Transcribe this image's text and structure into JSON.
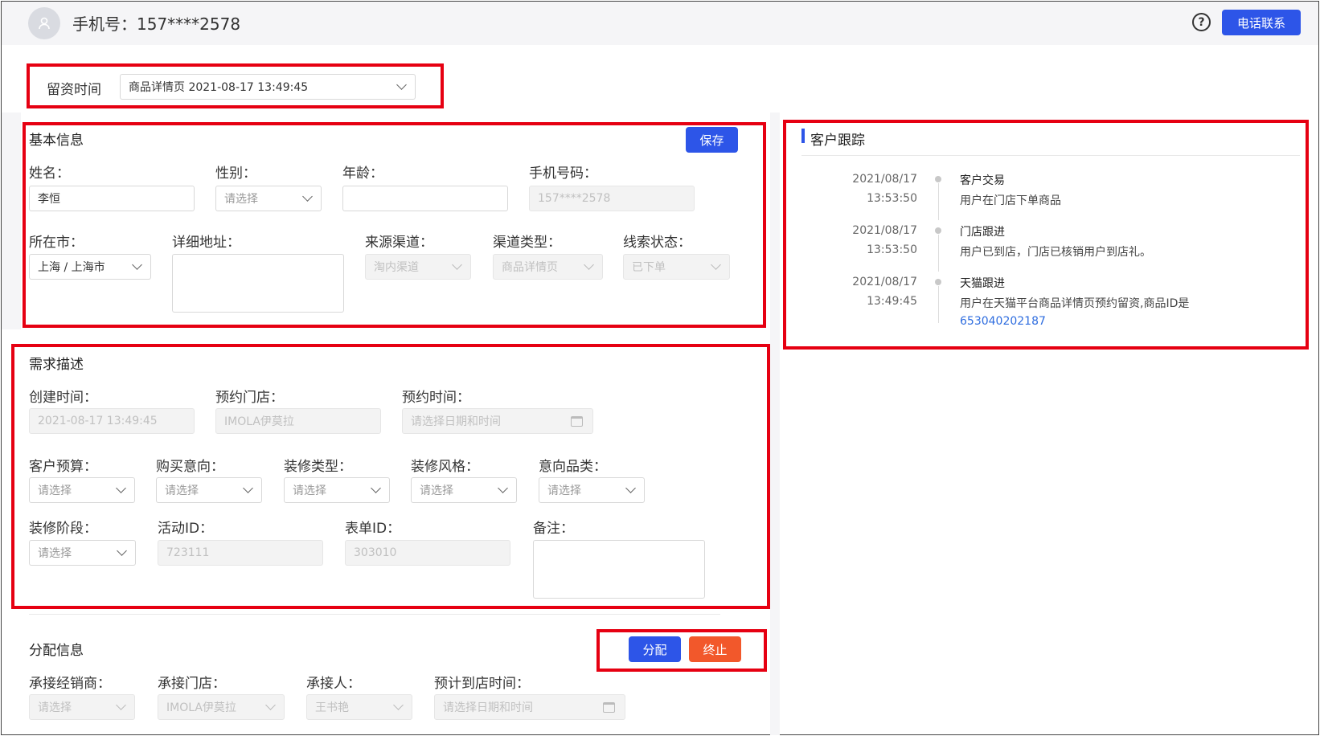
{
  "header": {
    "title": "手机号：157****2578",
    "help_icon": "?",
    "call_button": "电话联系"
  },
  "lead_time": {
    "label": "留资时间",
    "value": "商品详情页 2021-08-17 13:49:45"
  },
  "basic_info": {
    "title": "基本信息",
    "save_button": "保存",
    "name": {
      "label": "姓名：",
      "value": "李恒"
    },
    "gender": {
      "label": "性别：",
      "placeholder": "请选择"
    },
    "age": {
      "label": "年龄：",
      "value": ""
    },
    "phone": {
      "label": "手机号码：",
      "value": "157****2578"
    },
    "city": {
      "label": "所在市：",
      "value": "上海 / 上海市"
    },
    "address": {
      "label": "详细地址：",
      "value": ""
    },
    "source_channel": {
      "label": "来源渠道：",
      "value": "淘内渠道"
    },
    "channel_type": {
      "label": "渠道类型：",
      "value": "商品详情页"
    },
    "lead_status": {
      "label": "线索状态：",
      "value": "已下单"
    }
  },
  "tracking": {
    "title": "客户跟踪",
    "events": [
      {
        "date": "2021/08/17",
        "time": "13:53:50",
        "title": "客户交易",
        "desc": "用户在门店下单商品",
        "link": ""
      },
      {
        "date": "2021/08/17",
        "time": "13:53:50",
        "title": "门店跟进",
        "desc": "用户已到店，门店已核销用户到店礼。",
        "link": ""
      },
      {
        "date": "2021/08/17",
        "time": "13:49:45",
        "title": "天猫跟进",
        "desc": "用户在天猫平台商品详情页预约留资,商品ID是",
        "link": "653040202187"
      }
    ]
  },
  "demand": {
    "title": "需求描述",
    "created_time": {
      "label": "创建时间：",
      "value": "2021-08-17 13:49:45"
    },
    "store": {
      "label": "预约门店：",
      "value": "IMOLA伊莫拉"
    },
    "appt_time": {
      "label": "预约时间：",
      "placeholder": "请选择日期和时间"
    },
    "budget": {
      "label": "客户预算：",
      "placeholder": "请选择"
    },
    "intent": {
      "label": "购买意向：",
      "placeholder": "请选择"
    },
    "deco_type": {
      "label": "装修类型：",
      "placeholder": "请选择"
    },
    "deco_style": {
      "label": "装修风格：",
      "placeholder": "请选择"
    },
    "category": {
      "label": "意向品类：",
      "placeholder": "请选择"
    },
    "deco_stage": {
      "label": "装修阶段：",
      "placeholder": "请选择"
    },
    "activity_id": {
      "label": "活动ID：",
      "value": "723111"
    },
    "form_id": {
      "label": "表单ID：",
      "value": "303010"
    },
    "remark": {
      "label": "备注：",
      "value": ""
    }
  },
  "assign": {
    "title": "分配信息",
    "assign_button": "分配",
    "stop_button": "终止",
    "dealer": {
      "label": "承接经销商：",
      "placeholder": "请选择"
    },
    "store": {
      "label": "承接门店：",
      "value": "IMOLA伊莫拉"
    },
    "person": {
      "label": "承接人：",
      "value": "王书艳"
    },
    "arrival": {
      "label": "预计到店时间：",
      "placeholder": "请选择日期和时间"
    }
  },
  "colors": {
    "primary": "#2d55e8",
    "danger": "#f2582b",
    "highlight": "#e60012",
    "link": "#2d6cdf"
  }
}
